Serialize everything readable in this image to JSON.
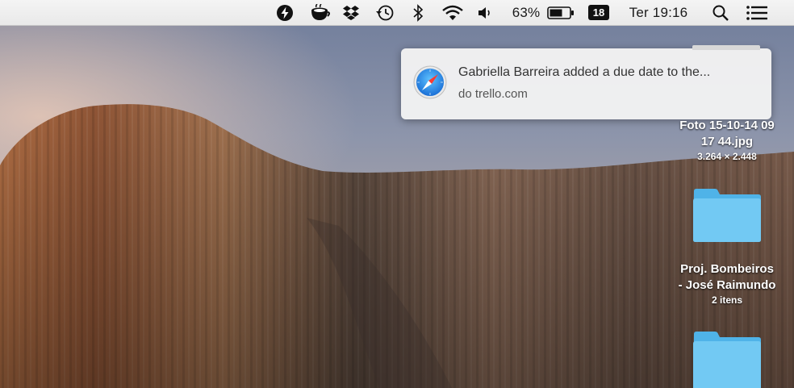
{
  "menubar": {
    "battery_percent": "63%",
    "calendar_day": "18",
    "clock": "Ter 19:16",
    "icons": [
      "lightning-icon",
      "coffee-cup-icon",
      "dropbox-icon",
      "time-machine-icon",
      "bluetooth-icon",
      "wifi-icon",
      "volume-icon",
      "battery-icon",
      "calendar-icon",
      "spotlight-search-icon",
      "notification-center-icon"
    ]
  },
  "notification": {
    "icon": "safari-compass-icon",
    "title": "Gabriella Barreira added a due date to the...",
    "subtitle": "do trello.com"
  },
  "desktop": {
    "items": [
      {
        "name_line1": "Foto 15-10-14 09",
        "name_line2": "17 44.jpg",
        "info": "3.264 × 2.448"
      },
      {
        "name_line1": "Proj. Bombeiros",
        "name_line2": "- José Raimundo",
        "info": "2 itens"
      }
    ]
  },
  "colors": {
    "folder": "#6cc7f2",
    "menubar": "#efefef",
    "safari_blue": "#2a8fe6"
  }
}
